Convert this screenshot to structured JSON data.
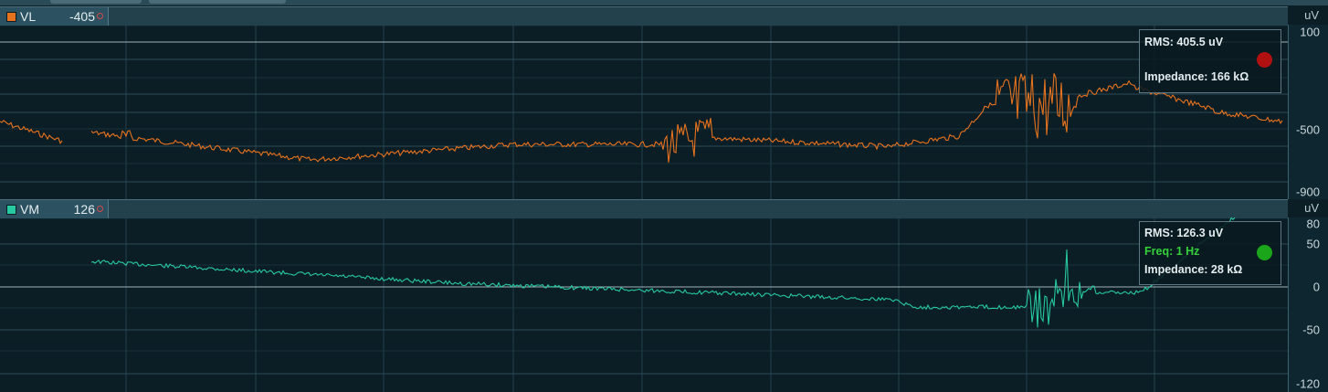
{
  "channels": [
    {
      "name": "VL",
      "value": "-405",
      "color": "#e8731e",
      "swatch_color": "#e8731e",
      "unit": "uV",
      "axis_ticks": [
        "100",
        "-500",
        "-900"
      ],
      "info": {
        "rms": "RMS: 405.5 uV",
        "freq": "",
        "impedance": "Impedance: 166 kΩ",
        "status_color": "#b01010"
      }
    },
    {
      "name": "VM",
      "value": "126",
      "color": "#27c9a0",
      "swatch_color": "#27c9a0",
      "unit": "uV",
      "axis_ticks": [
        "80",
        "50",
        "0",
        "-50",
        "-120"
      ],
      "info": {
        "rms": "RMS: 126.3 uV",
        "freq": "Freq: 1 Hz",
        "freq_color": "#34d13a",
        "impedance": "Impedance: 28 kΩ",
        "status_color": "#1aa51a"
      }
    }
  ]
}
